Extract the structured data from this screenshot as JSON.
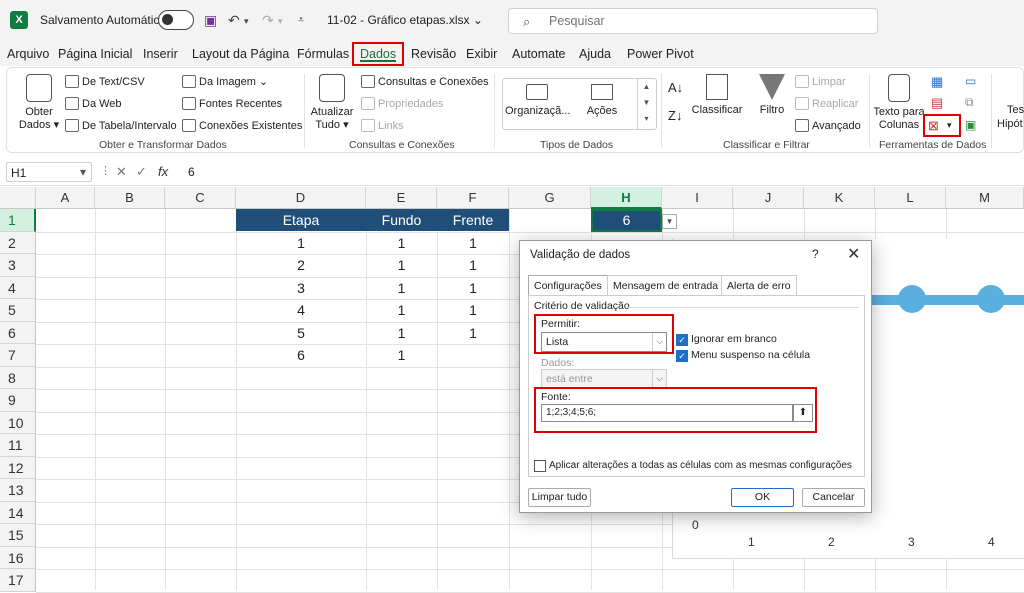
{
  "titlebar": {
    "logo": "X",
    "autosave_label": "Salvamento Automático",
    "autosave_on": false,
    "filename": "11-02 - Gráfico etapas.xlsx",
    "search_placeholder": "Pesquisar"
  },
  "menu": [
    "Arquivo",
    "Página Inicial",
    "Inserir",
    "Layout da Página",
    "Fórmulas",
    "Dados",
    "Revisão",
    "Exibir",
    "Automate",
    "Ajuda",
    "Power Pivot"
  ],
  "menu_active": "Dados",
  "ribbon": {
    "obter": {
      "big_label_1": "Obter",
      "big_label_2": "Dados",
      "items": [
        "De Text/CSV",
        "Da Web",
        "De Tabela/Intervalo",
        "Da Imagem",
        "Fontes Recentes",
        "Conexões Existentes"
      ],
      "group": "Obter e Transformar Dados"
    },
    "consultas": {
      "big_label_1": "Atualizar",
      "big_label_2": "Tudo",
      "items": [
        "Consultas e Conexões",
        "Propriedades",
        "Links"
      ],
      "group": "Consultas e Conexões"
    },
    "tipos": {
      "items": [
        "Organizaçã...",
        "Ações"
      ],
      "group": "Tipos de Dados"
    },
    "classificar": {
      "sort_label": "Classificar",
      "filter_label": "Filtro",
      "items": [
        "Limpar",
        "Reaplicar",
        "Avançado"
      ],
      "group": "Classificar e Filtrar"
    },
    "ferramentas": {
      "big_label_1": "Texto para",
      "big_label_2": "Colunas",
      "group": "Ferramentas de Dados"
    },
    "extra_1": "Test",
    "extra_2": "Hipót"
  },
  "formula_bar": {
    "name_box": "H1",
    "value": "6"
  },
  "sheet": {
    "columns": [
      "A",
      "B",
      "C",
      "D",
      "E",
      "F",
      "G",
      "H",
      "I",
      "J",
      "K",
      "L",
      "M"
    ],
    "rows": [
      "1",
      "2",
      "3",
      "4",
      "5",
      "6",
      "7",
      "8",
      "9",
      "10",
      "11",
      "12",
      "13",
      "14",
      "15",
      "16",
      "17"
    ],
    "headers": [
      "Etapa",
      "Fundo",
      "Frente"
    ],
    "data": [
      [
        "1",
        "1",
        "1"
      ],
      [
        "2",
        "1",
        "1"
      ],
      [
        "3",
        "1",
        "1"
      ],
      [
        "4",
        "1",
        "1"
      ],
      [
        "5",
        "1",
        "1"
      ],
      [
        "6",
        "1",
        ""
      ]
    ],
    "h1_value": "6",
    "selected_col": "H",
    "selected_row": "1"
  },
  "chart": {
    "x_labels": [
      "1",
      "2",
      "3",
      "4"
    ],
    "y_label_zero": "0",
    "color": "#5aaee0"
  },
  "dialog": {
    "title": "Validação de dados",
    "help": "?",
    "close": "✕",
    "tabs": [
      "Configurações",
      "Mensagem de entrada",
      "Alerta de erro"
    ],
    "active_tab": "Configurações",
    "section": "Critério de validação",
    "allow_label": "Permitir:",
    "allow_value": "Lista",
    "ignore_blank": "Ignorar em branco",
    "ignore_blank_checked": true,
    "dropdown_in_cell": "Menu suspenso na célula",
    "dropdown_in_cell_checked": true,
    "data_label": "Dados:",
    "data_value": "está entre",
    "source_label": "Fonte:",
    "source_value": "1;2;3;4;5;6;",
    "apply_all": "Aplicar alterações a todas as células com as mesmas configurações",
    "apply_all_checked": false,
    "clear_all": "Limpar tudo",
    "ok": "OK",
    "cancel": "Cancelar"
  }
}
